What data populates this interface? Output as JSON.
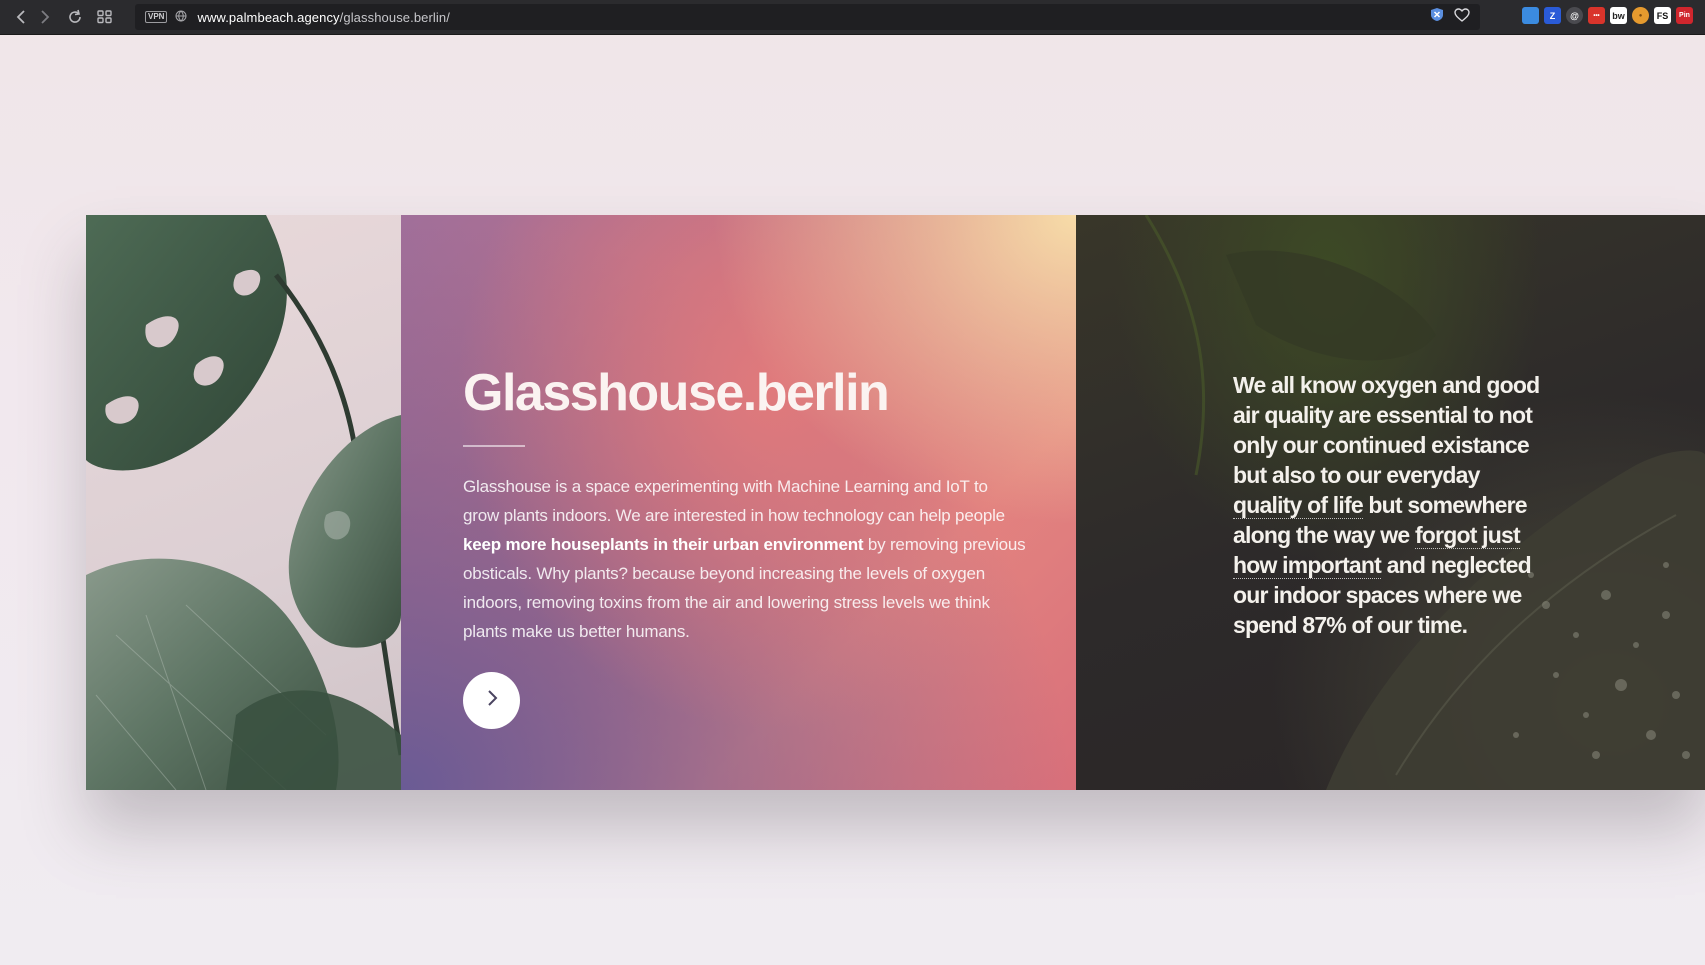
{
  "browser": {
    "vpn_label": "VPN",
    "url_host": "www.palmbeach.agency",
    "url_path": "/glasshouse.berlin/",
    "extensions": [
      {
        "name": "extension-icon-1",
        "label": "",
        "color": "#3b8be0"
      },
      {
        "name": "extension-icon-z",
        "label": "Z",
        "color": "#2a5bd7"
      },
      {
        "name": "extension-icon-at",
        "label": "@",
        "color": "#6d6d72"
      },
      {
        "name": "extension-icon-dots",
        "label": "•••",
        "color": "#d9342b"
      },
      {
        "name": "extension-icon-bw",
        "label": "bw",
        "color": "#ffffff"
      },
      {
        "name": "extension-icon-cookie",
        "label": "●",
        "color": "#e69a2e"
      },
      {
        "name": "extension-icon-fs",
        "label": "FS",
        "color": "#ffffff"
      },
      {
        "name": "extension-icon-pin",
        "label": "Pin",
        "color": "#d0262d"
      }
    ]
  },
  "hero": {
    "title": "Glasshouse.berlin",
    "description": {
      "part1": "Glasshouse is a space experimenting with Machine Learning and IoT to grow plants indoors. We are interested in how technology can help people ",
      "bold": "keep more houseplants in their urban environment",
      "part2": " by removing previous obsticals. Why plants? because beyond increasing the levels of oxygen indoors, removing toxins from the air and lowering stress levels we think plants make us better humans."
    },
    "next_icon": "chevron-right-icon"
  },
  "quote": {
    "p1": "We all know oxygen and good air quality are essential to not only our continued existance but also to our everyday ",
    "u1": "quality of life",
    "p2": " but somewhere along the way we ",
    "u2": "forgot just how important",
    "p3": " and neglected our indoor spaces where we spend 87% of our time."
  },
  "colors": {
    "gradient_peach": "#f7dca8",
    "gradient_coral": "#e07a7c",
    "gradient_purple": "#6a5b95",
    "leaf_green": "#3f5a45"
  }
}
